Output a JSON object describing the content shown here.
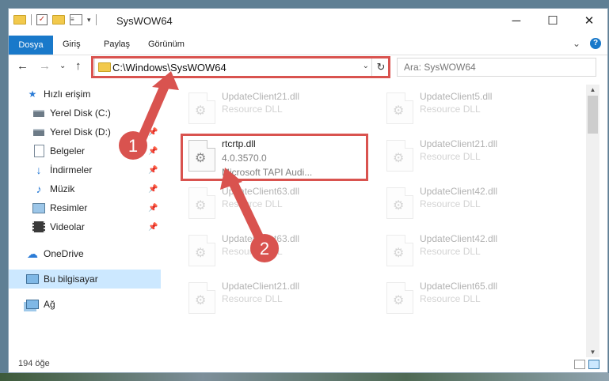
{
  "window": {
    "title": "SysWOW64",
    "minimize_glyph": "─",
    "maximize_glyph": "☐",
    "close_glyph": "✕"
  },
  "ribbon": {
    "tabs": [
      "Dosya",
      "Giriş",
      "Paylaş",
      "Görünüm"
    ],
    "expand_glyph": "⌄",
    "help_glyph": "?"
  },
  "nav": {
    "back_glyph": "←",
    "forward_glyph": "→",
    "recent_glyph": "⌄",
    "up_glyph": "↑",
    "address": "C:\\Windows\\SysWOW64",
    "address_dropdown_glyph": "⌄",
    "refresh_glyph": "↻",
    "search_placeholder": "Ara: SysWOW64"
  },
  "sidebar": {
    "items": [
      {
        "label": "Hızlı erişim",
        "icon": "star-icon",
        "pinned": false
      },
      {
        "label": "Yerel Disk (C:)",
        "icon": "drive-icon",
        "pinned": true
      },
      {
        "label": "Yerel Disk (D:)",
        "icon": "drive-icon",
        "pinned": true
      },
      {
        "label": "Belgeler",
        "icon": "documents-icon",
        "pinned": true
      },
      {
        "label": "İndirmeler",
        "icon": "download-icon",
        "pinned": true
      },
      {
        "label": "Müzik",
        "icon": "music-icon",
        "pinned": true
      },
      {
        "label": "Resimler",
        "icon": "pictures-icon",
        "pinned": true
      },
      {
        "label": "Videolar",
        "icon": "videos-icon",
        "pinned": true
      },
      {
        "label": "OneDrive",
        "icon": "cloud-icon",
        "pinned": false
      },
      {
        "label": "Bu bilgisayar",
        "icon": "computer-icon",
        "pinned": false,
        "selected": true
      },
      {
        "label": "Ağ",
        "icon": "network-icon",
        "pinned": false
      }
    ]
  },
  "files": {
    "highlighted": {
      "name": "rtcrtp.dll",
      "version": "4.0.3570.0",
      "description": "Microsoft TAPI Audi..."
    },
    "faded_left": [
      {
        "name": "UpdateClient21.dll",
        "description": "Resource DLL"
      },
      {
        "name": "UpdateClient63.dll",
        "description": "Resource DLL"
      },
      {
        "name": "UpdateClient63.dll",
        "description": "Resource DLL"
      },
      {
        "name": "UpdateClient21.dll",
        "description": "Resource DLL"
      }
    ],
    "faded_right": [
      {
        "name": "UpdateClient5.dll",
        "description": "Resource DLL"
      },
      {
        "name": "UpdateClient21.dll",
        "description": "Resource DLL"
      },
      {
        "name": "UpdateClient42.dll",
        "description": "Resource DLL"
      },
      {
        "name": "UpdateClient42.dll",
        "description": "Resource DLL"
      },
      {
        "name": "UpdateClient65.dll",
        "description": "Resource DLL"
      }
    ]
  },
  "status": {
    "item_count": "194 öğe"
  },
  "annotations": {
    "step1": "1",
    "step2": "2",
    "color": "#d9534f"
  }
}
